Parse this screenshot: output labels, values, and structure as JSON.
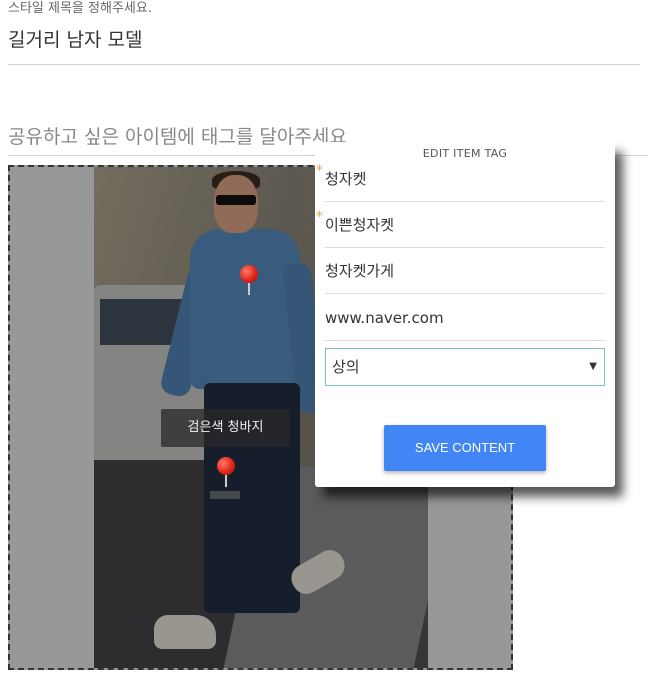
{
  "style_section": {
    "label": "스타일 제목을 정해주세요.",
    "title_value": "길거리 남자 모델"
  },
  "tag_section": {
    "heading": "공유하고 싶은 아이템에 태그를 달아주세요"
  },
  "image_tags": [
    {
      "label": "검은색 청바지"
    }
  ],
  "edit_modal": {
    "title": "EDIT ITEM TAG",
    "fields": [
      {
        "value": "청자켓",
        "required": true,
        "required_mark": "*"
      },
      {
        "value": "이쁜청자켓",
        "required": true,
        "required_mark": "*"
      },
      {
        "value": "청자켓가게",
        "required": false
      },
      {
        "value": "www.naver.com",
        "required": false
      }
    ],
    "category_select": {
      "value": "상의",
      "arrow": "▼"
    },
    "save_label": "SAVE CONTENT"
  },
  "colors": {
    "accent": "#4285f4",
    "pin": "#e0251a",
    "required_mark": "#e2a14a",
    "select_border": "#7fc2c4"
  }
}
